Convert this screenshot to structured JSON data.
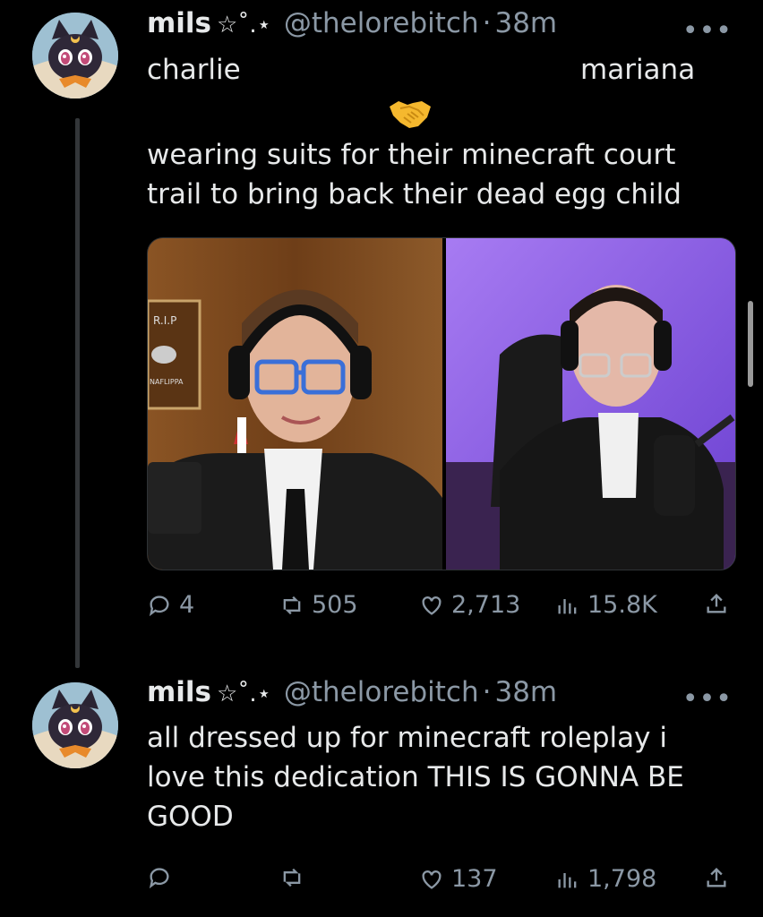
{
  "tweets": [
    {
      "display_name": "mils",
      "badge": "☆˚.⋆",
      "handle": "@thelorebitch",
      "separator": "·",
      "time": "38m",
      "label_left": "charlie",
      "label_right": "mariana",
      "body": "wearing suits for their minecraft court trail to bring back their dead egg child",
      "stats": {
        "replies": "4",
        "reposts": "505",
        "likes": "2,713",
        "views": "15.8K"
      }
    },
    {
      "display_name": "mils",
      "badge": "☆˚.⋆",
      "handle": "@thelorebitch",
      "separator": "·",
      "time": "38m",
      "body": "all dressed up for minecraft roleplay i love this dedication THIS IS GONNA BE GOOD",
      "stats": {
        "replies": "",
        "reposts": "",
        "likes": "137",
        "views": "1,798"
      }
    }
  ],
  "more_icon": "•••",
  "media_sign": {
    "title": "R.I.P",
    "name": "NAFLIPPA"
  },
  "icons": [
    "reply-icon",
    "repost-icon",
    "like-icon",
    "views-icon",
    "share-icon",
    "handshake-emoji",
    "more-icon"
  ],
  "colors": {
    "background": "#000000",
    "text": "#e7e9ea",
    "muted": "#8b98a5",
    "thread_line": "#333639"
  }
}
